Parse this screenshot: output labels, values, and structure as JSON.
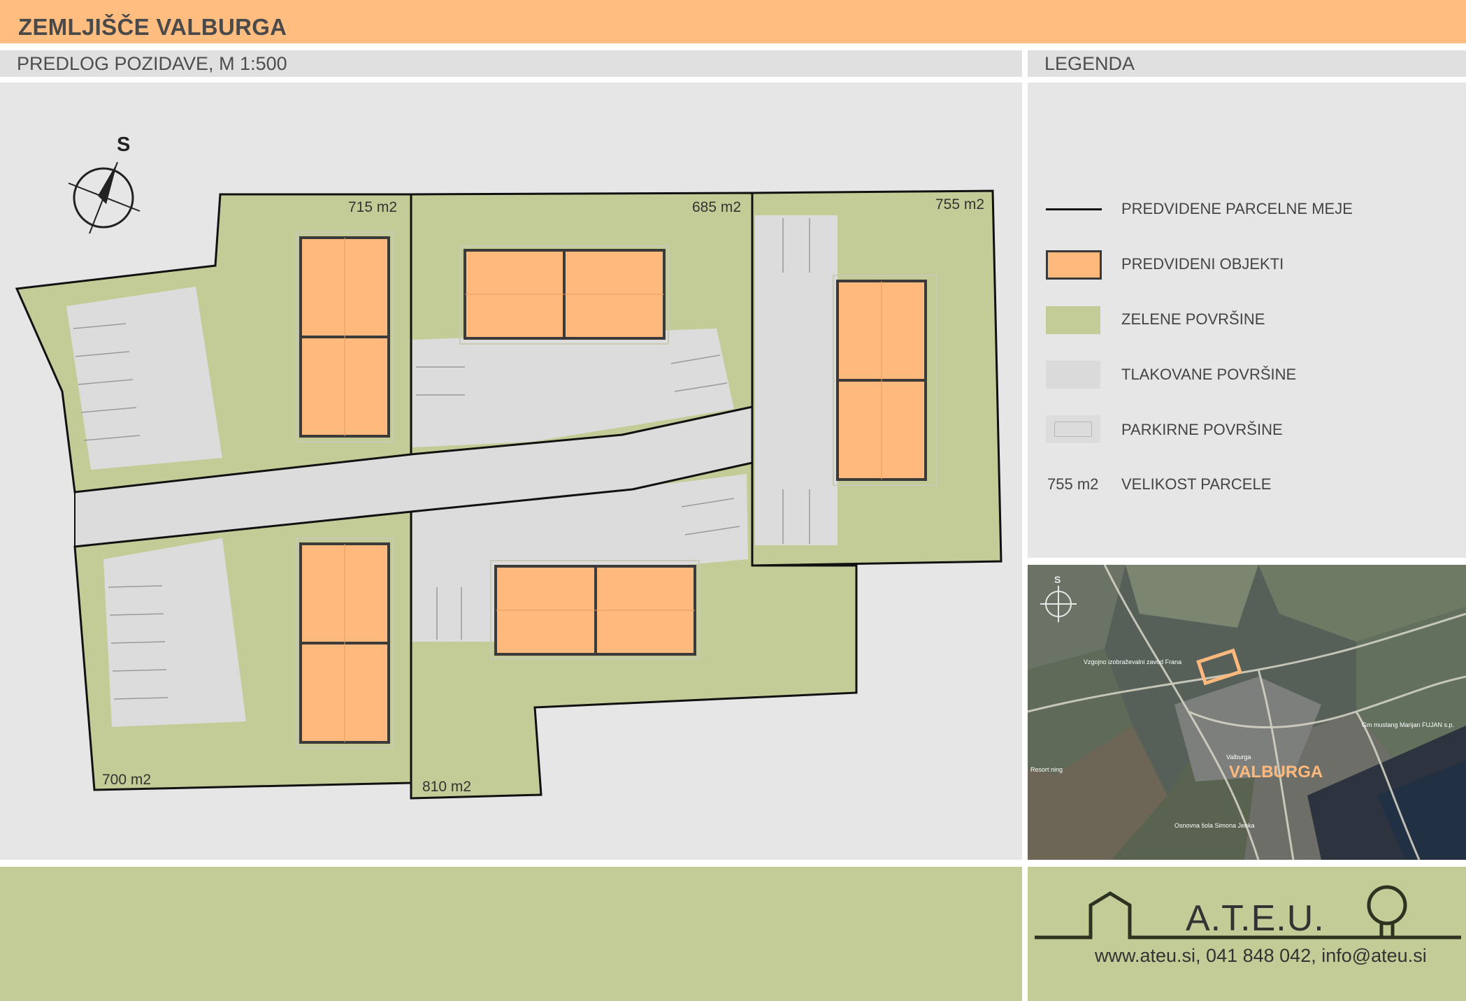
{
  "header": {
    "title": "ZEMLJIŠČE VALBURGA",
    "plan_subtitle": "PREDLOG POZIDAVE, M 1:500",
    "legend_subtitle": "LEGENDA"
  },
  "plan": {
    "compass_label": "S",
    "parcels": [
      {
        "id": "NW",
        "area": "715 m2"
      },
      {
        "id": "N-center",
        "area": "685 m2"
      },
      {
        "id": "E",
        "area": "755 m2"
      },
      {
        "id": "SW",
        "area": "700 m2"
      },
      {
        "id": "S-center",
        "area": "810 m2"
      }
    ]
  },
  "legend": {
    "items": [
      {
        "key": "boundary",
        "label": "PREDVIDENE PARCELNE MEJE"
      },
      {
        "key": "buildings",
        "label": "PREDVIDENI OBJEKTI",
        "color": "#ffb97d"
      },
      {
        "key": "green",
        "label": "ZELENE POVRŠINE",
        "color": "#c3cc96"
      },
      {
        "key": "paved",
        "label": "TLAKOVANE POVRŠINE",
        "color": "#dadada"
      },
      {
        "key": "parking",
        "label": "PARKIRNE POVRŠINE",
        "color": "#e0e0e0"
      },
      {
        "key": "size",
        "sample": "755 m2",
        "label": "VELIKOST PARCELE"
      }
    ]
  },
  "location_map": {
    "compass_label": "S",
    "place_label": "VALBURGA",
    "poi_labels": [
      "Vzgojno izobraževalni zavod Frana",
      "Gm mustang Marijan FUJAN s.p.",
      "Resort ning",
      "Osnovna šola Simona Jenka",
      "Valburga"
    ]
  },
  "footer": {
    "logo_text": "A.T.E.U.",
    "contact": "www.ateu.si, 041 848 042, info@ateu.si"
  },
  "colors": {
    "accent_orange": "#ffbe80",
    "building_orange": "#ffb97d",
    "green": "#c3cc96",
    "panel_gray": "#e6e6e6",
    "paved_gray": "#dadada"
  }
}
